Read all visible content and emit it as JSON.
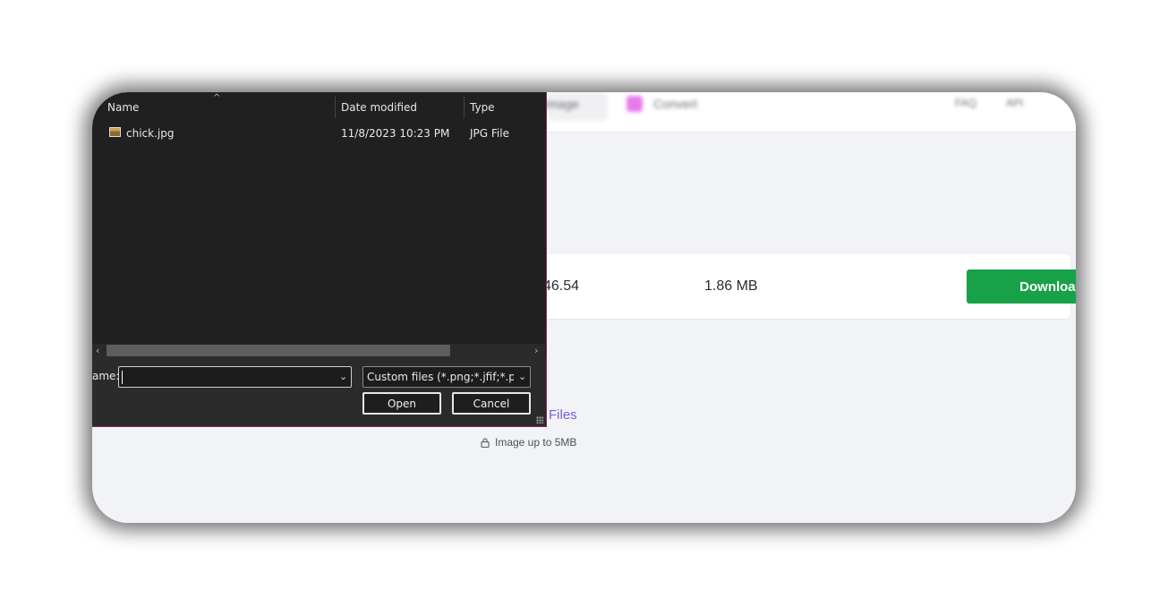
{
  "web_page": {
    "nav": {
      "tab_image": "Image",
      "convert": "Convert",
      "faq": "FAQ",
      "api": "API"
    },
    "result": {
      "value_partial": "46.54",
      "size": "1.86 MB",
      "download_label": "Download"
    },
    "upload": {
      "files_link": "Files",
      "limit_note": "Image up to 5MB"
    },
    "colors": {
      "download": "#17a24a",
      "link": "#7c5ce6",
      "page_bg": "#f2f3f7"
    }
  },
  "dialog": {
    "columns": {
      "name": "Name",
      "date_modified": "Date modified",
      "type": "Type"
    },
    "files": [
      {
        "name": "chick.jpg",
        "date": "11/8/2023 10:23 PM",
        "type": "JPG File",
        "icon": "image-file-icon"
      }
    ],
    "file_name_label": "ame:",
    "file_name_value": "",
    "file_type_selected": "Custom files (*.png;*.jfif;*.pjpeg",
    "open_label": "Open",
    "cancel_label": "Cancel"
  }
}
